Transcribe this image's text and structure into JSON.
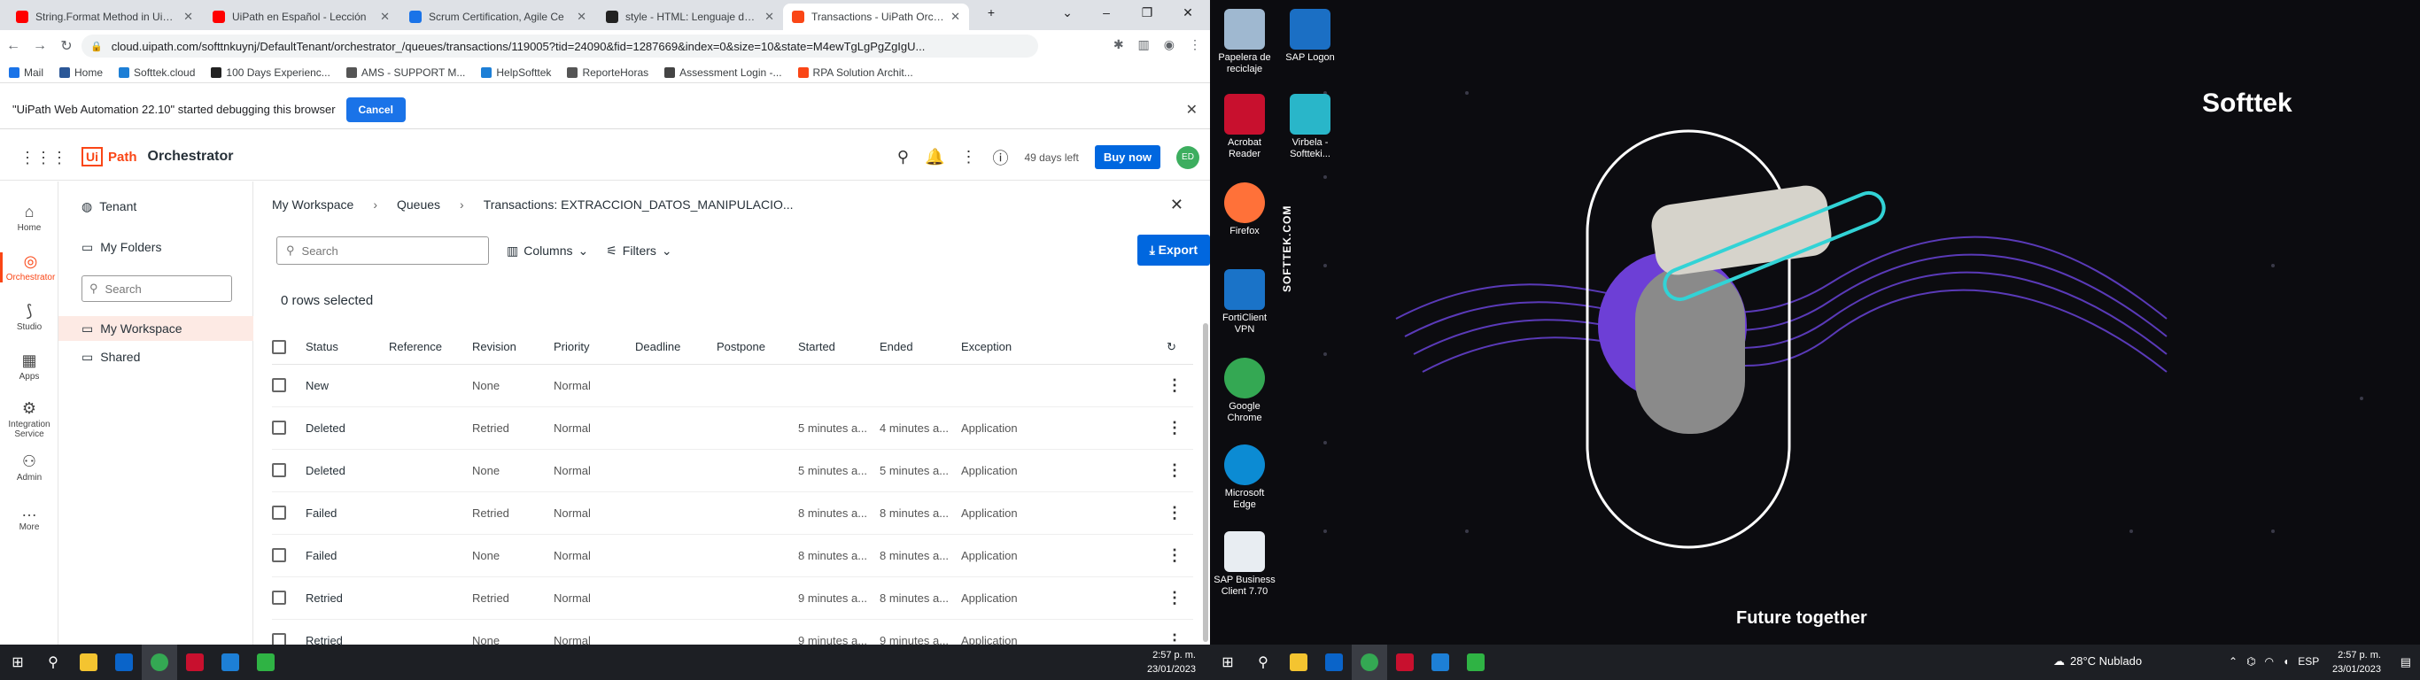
{
  "browser": {
    "tabs": [
      {
        "title": "String.Format Method in UiPath",
        "color": "#ff0000"
      },
      {
        "title": "UiPath en Español - Lección",
        "color": "#ff0000"
      },
      {
        "title": "Scrum Certification, Agile Ce",
        "color": "#1a73e8"
      },
      {
        "title": "style - HTML: Lenguaje de etiq",
        "color": "#222222"
      },
      {
        "title": "Transactions - UiPath Orches",
        "color": "#fa4616"
      }
    ],
    "url": "cloud.uipath.com/softtnkuynj/DefaultTenant/orchestrator_/queues/transactions/119005?tid=24090&fid=1287669&index=0&size=10&state=M4ewTgLgPgZgIgU...",
    "bookmarks": [
      "Mail",
      "Home",
      "Softtek.cloud",
      "100 Days Experienc...",
      "AMS - SUPPORT M...",
      "HelpSofttek",
      "ReporteHoras",
      "Assessment Login -...",
      "RPA Solution Archit..."
    ]
  },
  "debug": {
    "message": "\"UiPath Web Automation 22.10\" started debugging this browser",
    "cancel": "Cancel"
  },
  "header": {
    "brand_ui": "Ui",
    "brand_path": "Path",
    "product": "Orchestrator",
    "trial": "49 days left",
    "buy": "Buy now",
    "avatar": "ED"
  },
  "rail": [
    {
      "label": "Home",
      "icon": "⌂"
    },
    {
      "label": "Orchestrator",
      "icon": "◎"
    },
    {
      "label": "Studio",
      "icon": "⟆"
    },
    {
      "label": "Apps",
      "icon": "▦"
    },
    {
      "label": "Integration Service",
      "icon": "⚙"
    },
    {
      "label": "Admin",
      "icon": "⚇"
    },
    {
      "label": "More",
      "icon": "…"
    }
  ],
  "folders": {
    "tenant": "Tenant",
    "my_folders": "My Folders",
    "search": "Search",
    "workspace": "My Workspace",
    "shared": "Shared"
  },
  "breadcrumb": {
    "a": "My Workspace",
    "b": "Queues",
    "c": "Transactions: EXTRACCION_DATOS_MANIPULACIO..."
  },
  "toolbar": {
    "search": "Search",
    "columns": "Columns",
    "filters": "Filters",
    "export": "Export"
  },
  "selection": "0 rows selected",
  "table": {
    "headers": [
      "Status",
      "Reference",
      "Revision",
      "Priority",
      "Deadline",
      "Postpone",
      "Started",
      "Ended",
      "Exception"
    ],
    "rows": [
      {
        "status": "New",
        "revision": "None",
        "priority": "Normal",
        "started": "",
        "ended": "",
        "exception": ""
      },
      {
        "status": "Deleted",
        "revision": "Retried",
        "priority": "Normal",
        "started": "5 minutes a...",
        "ended": "4 minutes a...",
        "exception": "Application"
      },
      {
        "status": "Deleted",
        "revision": "None",
        "priority": "Normal",
        "started": "5 minutes a...",
        "ended": "5 minutes a...",
        "exception": "Application"
      },
      {
        "status": "Failed",
        "revision": "Retried",
        "priority": "Normal",
        "started": "8 minutes a...",
        "ended": "8 minutes a...",
        "exception": "Application"
      },
      {
        "status": "Failed",
        "revision": "None",
        "priority": "Normal",
        "started": "8 minutes a...",
        "ended": "8 minutes a...",
        "exception": "Application"
      },
      {
        "status": "Retried",
        "revision": "Retried",
        "priority": "Normal",
        "started": "9 minutes a...",
        "ended": "8 minutes a...",
        "exception": "Application"
      },
      {
        "status": "Retried",
        "revision": "None",
        "priority": "Normal",
        "started": "9 minutes a...",
        "ended": "9 minutes a...",
        "exception": "Application"
      }
    ]
  },
  "taskbar": {
    "time": "2:57 p. m.",
    "date": "23/01/2023",
    "weather": "28°C  Nublado",
    "lang": "ESP"
  },
  "desktop": {
    "icons": [
      {
        "label": "Papelera de reciclaje",
        "color": "#9fb8d0"
      },
      {
        "label": "SAP Logon",
        "color": "#1b6fc4"
      },
      {
        "label": "Acrobat Reader",
        "color": "#c8102e"
      },
      {
        "label": "Virbela - Softteki...",
        "color": "#29b6c9"
      },
      {
        "label": "Firefox",
        "color": "#ff7139"
      },
      {
        "label": "FortiClient VPN",
        "color": "#1a73c8"
      },
      {
        "label": "Google Chrome",
        "color": "#34a853"
      },
      {
        "label": "Microsoft Edge",
        "color": "#0c8bd3"
      },
      {
        "label": "SAP Business Client 7.70",
        "color": "#e8edf2"
      }
    ],
    "brand": "Softtek",
    "vertical": "SOFTTEK.COM",
    "tagline": "Future together"
  }
}
